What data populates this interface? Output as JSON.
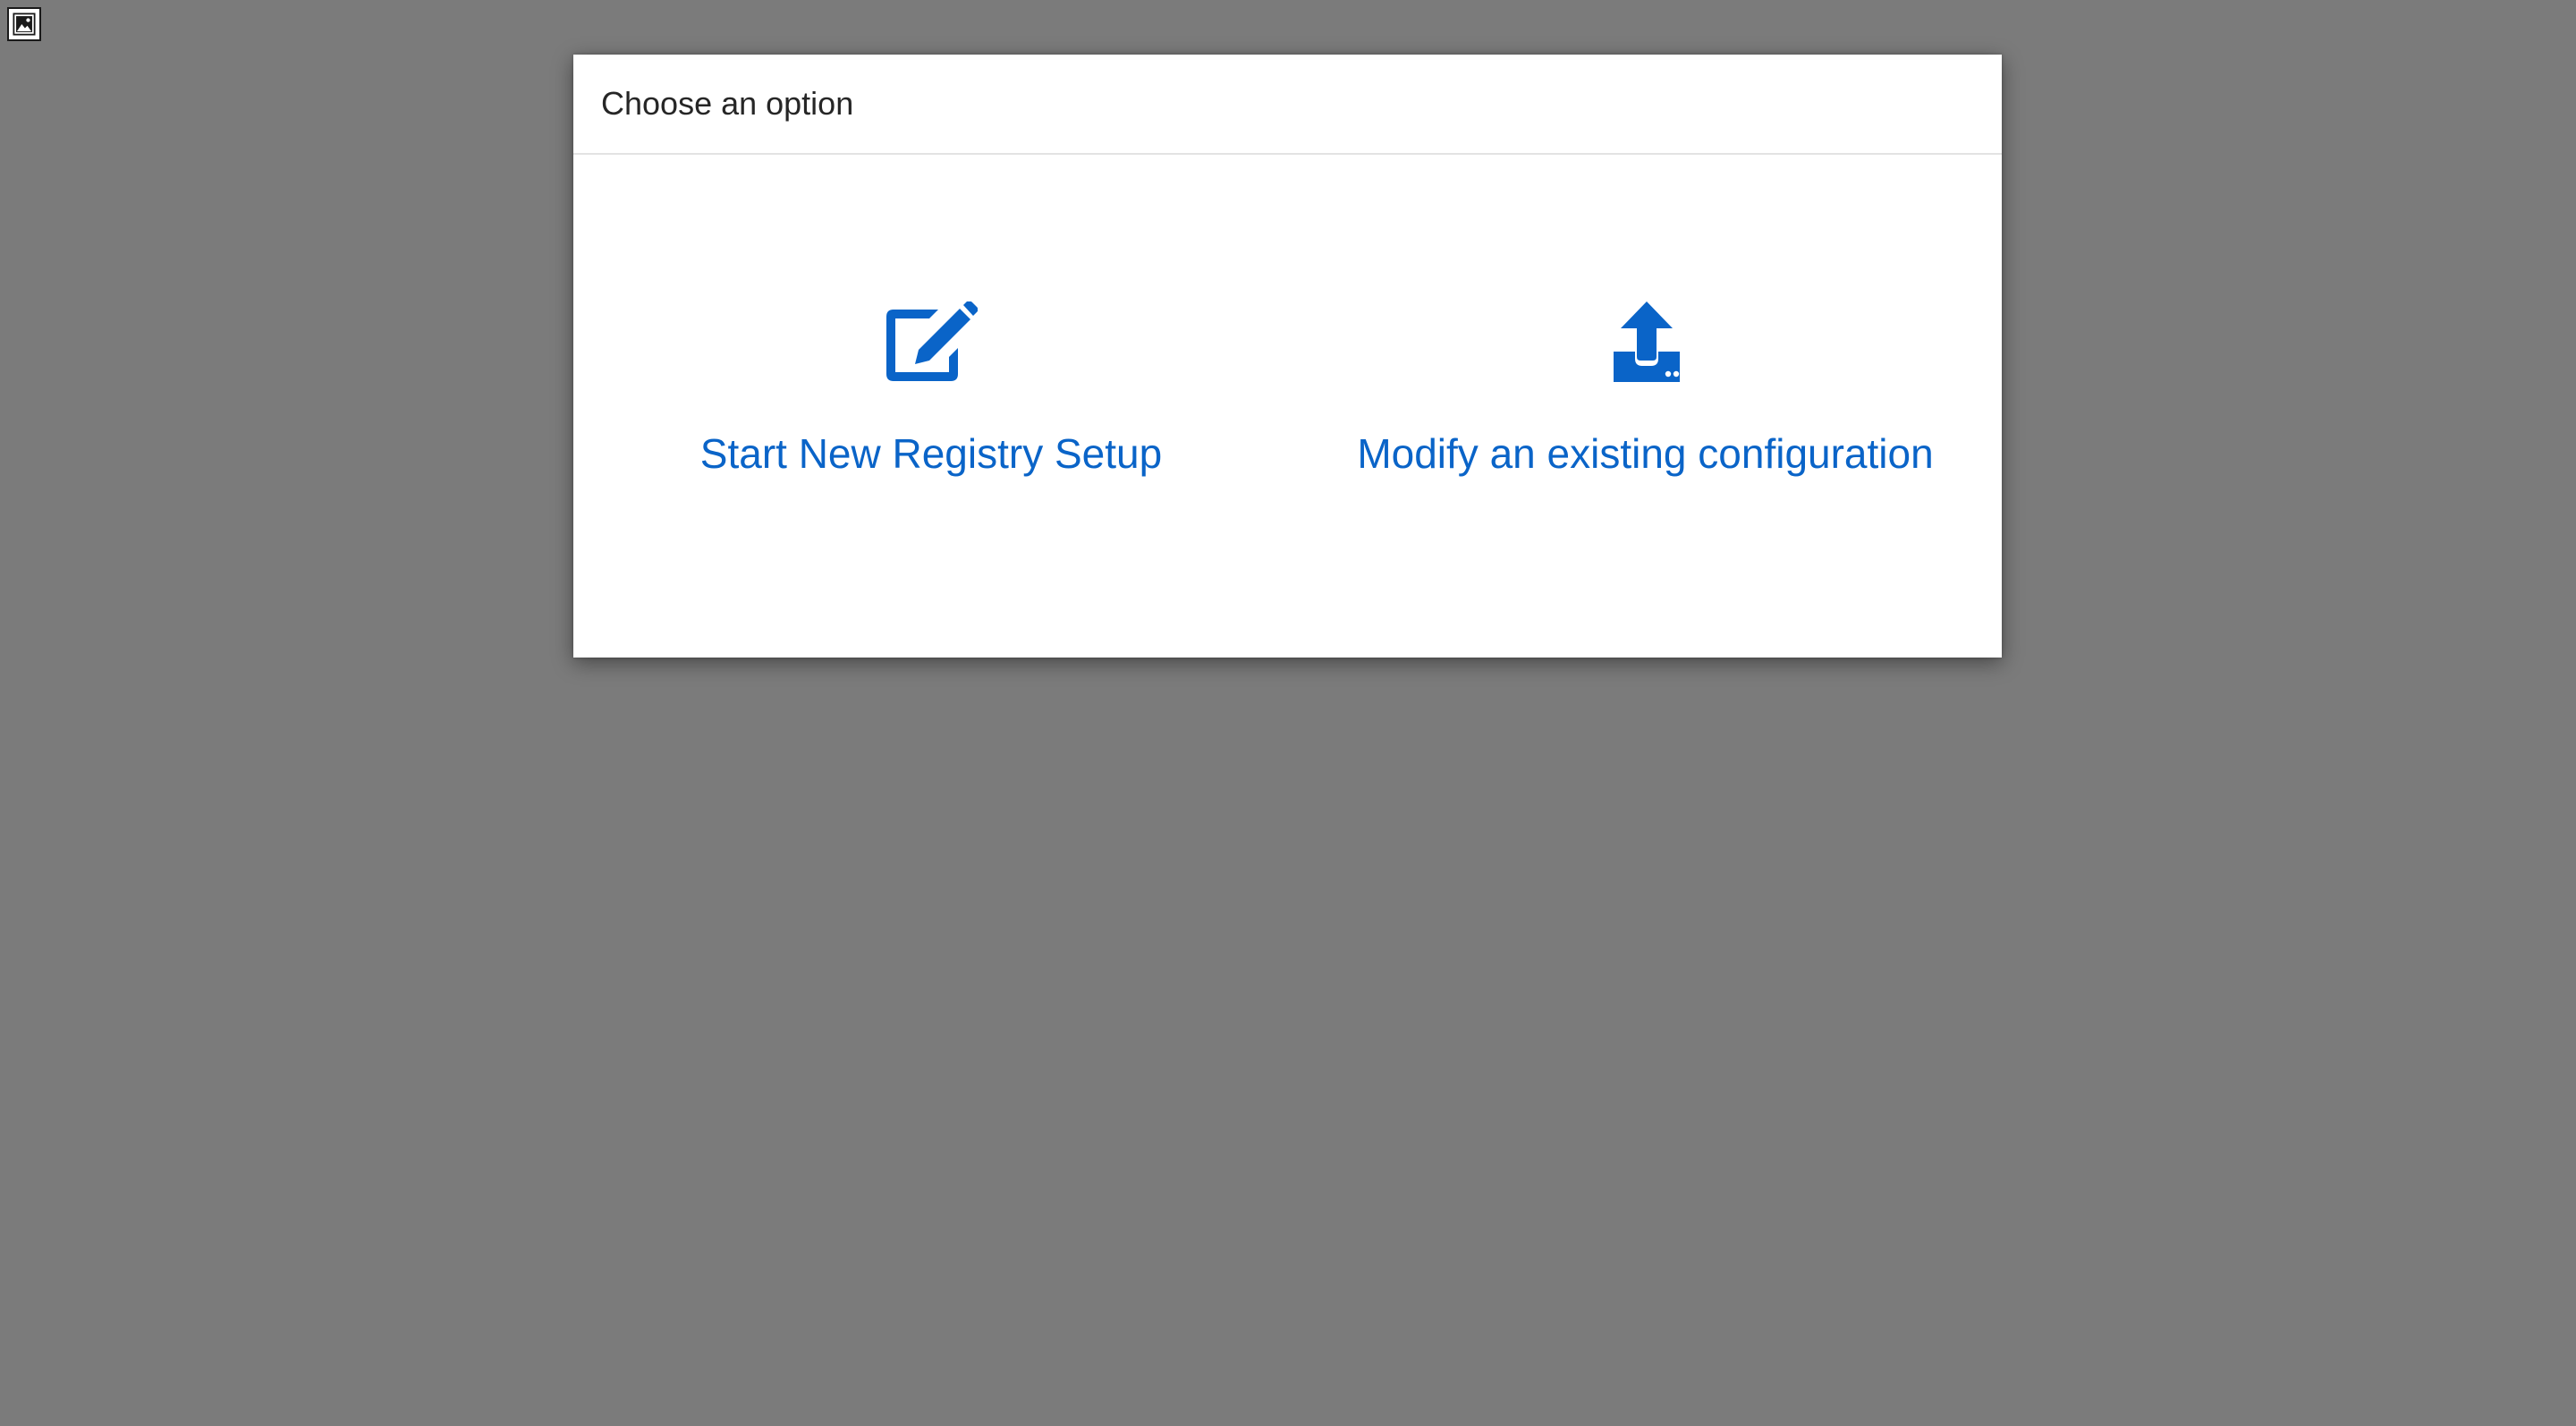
{
  "dialog": {
    "title": "Choose an option",
    "options": [
      {
        "label": "Start New Registry Setup",
        "icon": "edit-icon"
      },
      {
        "label": "Modify an existing configuration",
        "icon": "upload-icon"
      }
    ]
  },
  "colors": {
    "backdrop": "#7b7b7b",
    "accent": "#0a64c8",
    "title_text": "#262626",
    "divider": "#e3e3e3"
  },
  "icons": {
    "corner": "broken-image-icon"
  }
}
